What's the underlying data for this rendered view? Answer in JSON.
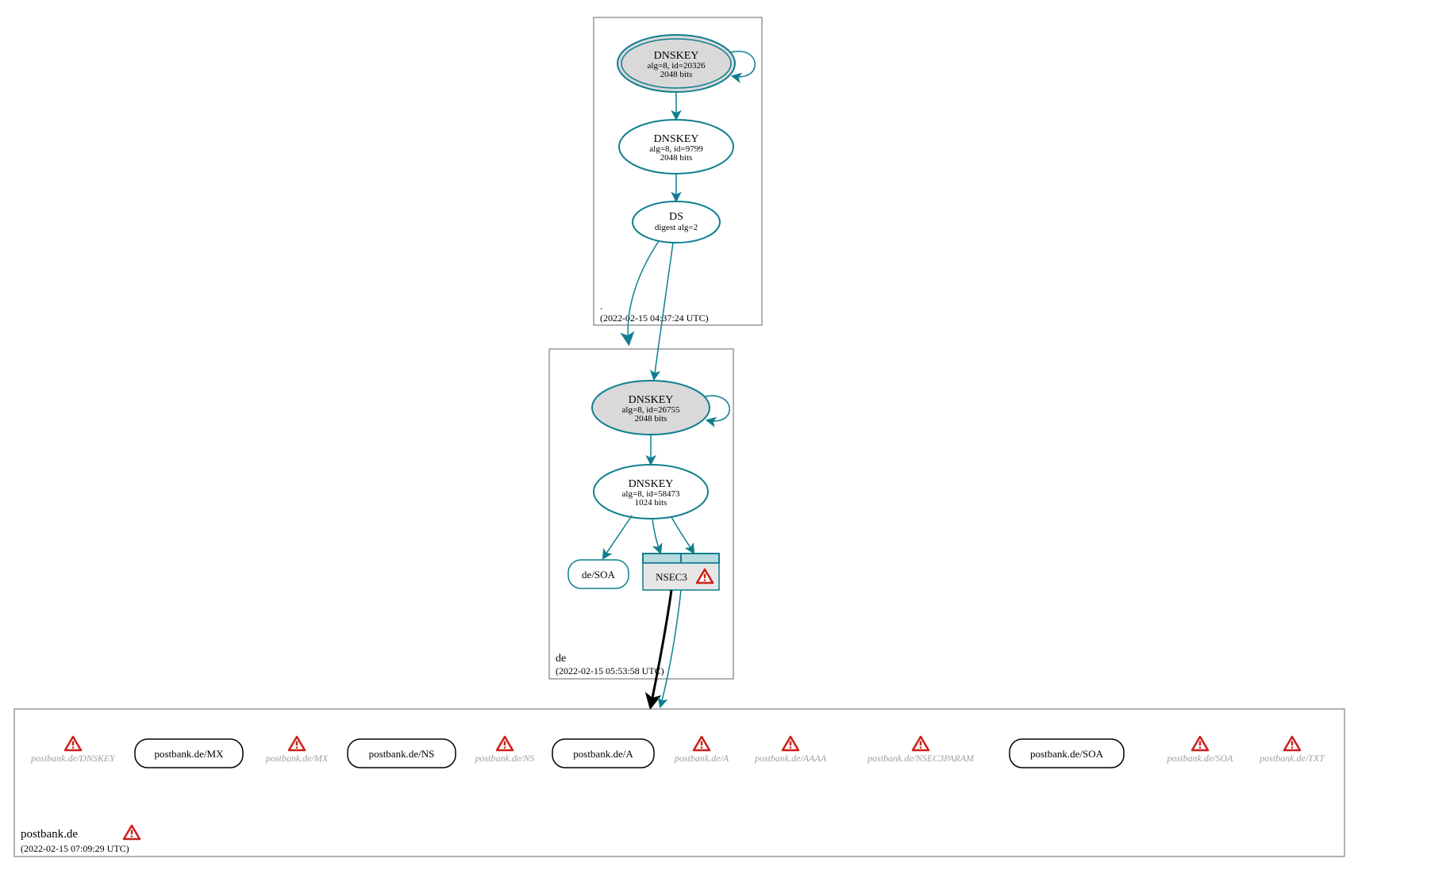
{
  "colors": {
    "teal": "#0f7f8f",
    "grey_fill": "#d9d9d9",
    "nsec_fill": "#b7dadf",
    "ghost_text": "#9f9f9f"
  },
  "zones": {
    "root": {
      "title": ".",
      "timestamp": "(2022-02-15 04:37:24 UTC)",
      "nodes": {
        "dnskey1": {
          "title": "DNSKEY",
          "line2": "alg=8, id=20326",
          "line3": "2048 bits"
        },
        "dnskey2": {
          "title": "DNSKEY",
          "line2": "alg=8, id=9799",
          "line3": "2048 bits"
        },
        "ds": {
          "title": "DS",
          "line2": "digest alg=2"
        }
      }
    },
    "de": {
      "title": "de",
      "timestamp": "(2022-02-15 05:53:58 UTC)",
      "nodes": {
        "dnskey1": {
          "title": "DNSKEY",
          "line2": "alg=8, id=26755",
          "line3": "2048 bits"
        },
        "dnskey2": {
          "title": "DNSKEY",
          "line2": "alg=8, id=58473",
          "line3": "1024 bits"
        },
        "soa": {
          "label": "de/SOA"
        },
        "nsec3": {
          "label": "NSEC3"
        }
      }
    },
    "postbank": {
      "title": "postbank.de",
      "timestamp": "(2022-02-15 07:09:29 UTC)",
      "nodes": [
        {
          "kind": "ghost",
          "label": "postbank.de/DNSKEY"
        },
        {
          "kind": "rr",
          "label": "postbank.de/MX"
        },
        {
          "kind": "ghost",
          "label": "postbank.de/MX"
        },
        {
          "kind": "rr",
          "label": "postbank.de/NS"
        },
        {
          "kind": "ghost",
          "label": "postbank.de/NS"
        },
        {
          "kind": "rr",
          "label": "postbank.de/A"
        },
        {
          "kind": "ghost",
          "label": "postbank.de/A"
        },
        {
          "kind": "ghost",
          "label": "postbank.de/AAAA"
        },
        {
          "kind": "ghost",
          "label": "postbank.de/NSEC3PARAM"
        },
        {
          "kind": "rr",
          "label": "postbank.de/SOA"
        },
        {
          "kind": "ghost",
          "label": "postbank.de/SOA"
        },
        {
          "kind": "ghost",
          "label": "postbank.de/TXT"
        }
      ]
    }
  }
}
